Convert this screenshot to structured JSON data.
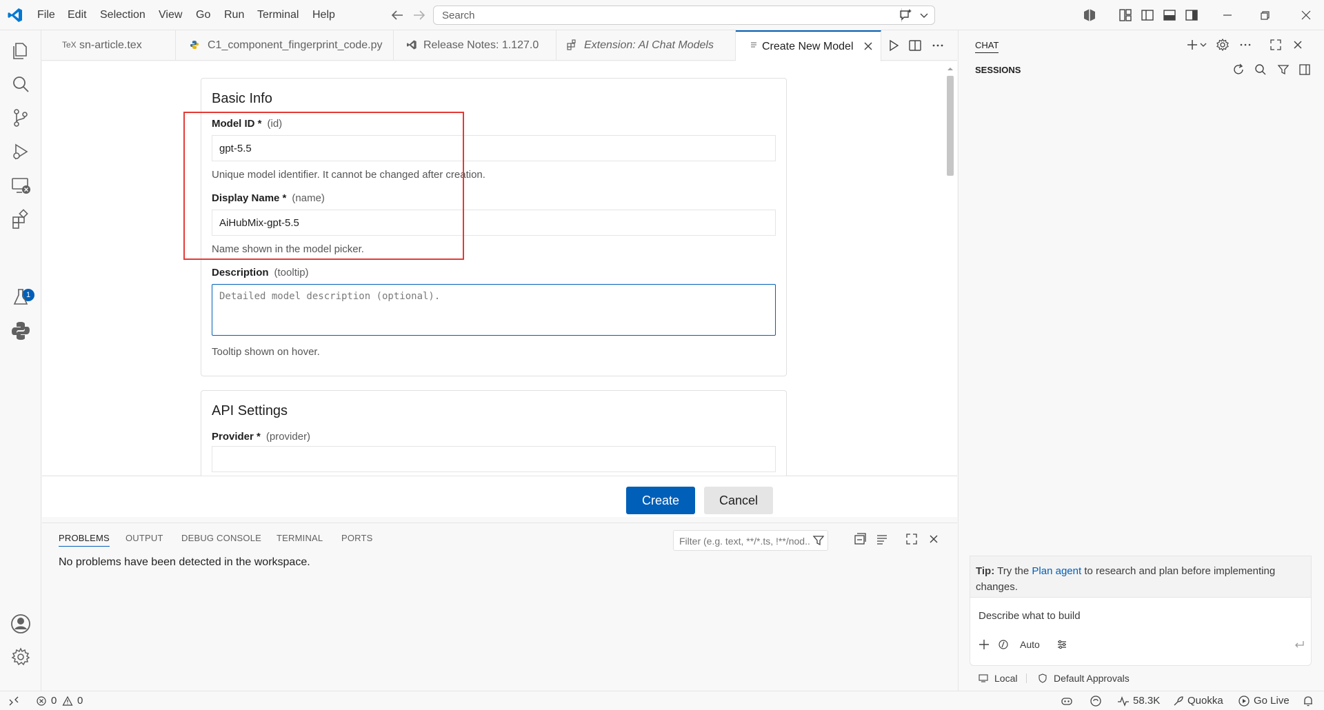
{
  "menu": [
    "File",
    "Edit",
    "Selection",
    "View",
    "Go",
    "Run",
    "Terminal",
    "Help"
  ],
  "search": {
    "placeholder": "Search"
  },
  "activity_badge": "1",
  "tabs": [
    {
      "label": "sn-article.tex",
      "icon": "tex-file-icon",
      "icon_text": "TeX"
    },
    {
      "label": "C1_component_fingerprint_code.py",
      "icon": "python-file-icon"
    },
    {
      "label": "Release Notes: 1.127.0",
      "icon": "vscode-icon"
    },
    {
      "label": "Extension: AI Chat Models",
      "icon": "extensions-icon"
    },
    {
      "label": "Create New Model",
      "icon": "preview-icon"
    }
  ],
  "form": {
    "basic_info_title": "Basic Info",
    "model_id": {
      "label": "Model ID *",
      "key": "(id)",
      "value": "gpt-5.5",
      "hint": "Unique model identifier. It cannot be changed after creation."
    },
    "display_name": {
      "label": "Display Name *",
      "key": "(name)",
      "value": "AiHubMix-gpt-5.5",
      "hint": "Name shown in the model picker."
    },
    "description": {
      "label": "Description",
      "key": "(tooltip)",
      "placeholder": "Detailed model description (optional).",
      "hint": "Tooltip shown on hover."
    },
    "api_settings_title": "API Settings",
    "provider": {
      "label": "Provider *",
      "key": "(provider)",
      "value": ""
    },
    "create_label": "Create",
    "cancel_label": "Cancel"
  },
  "panel": {
    "tabs": [
      "PROBLEMS",
      "OUTPUT",
      "DEBUG CONSOLE",
      "TERMINAL",
      "PORTS"
    ],
    "filter_placeholder": "Filter (e.g. text, **/*.ts, !**/nod...",
    "message": "No problems have been detected in the workspace."
  },
  "chat": {
    "title": "CHAT",
    "sessions": "SESSIONS",
    "tip_prefix": "Tip:",
    "tip_pre": "Try the",
    "tip_link": "Plan agent",
    "tip_post": "to research and plan before implementing changes.",
    "input_placeholder": "Describe what to build",
    "mode": "Auto",
    "location": "Local",
    "approvals": "Default Approvals"
  },
  "status": {
    "errors": "0",
    "warnings": "0",
    "tokens": "58.3K",
    "quokka": "Quokka",
    "go_live": "Go Live"
  },
  "colors": {
    "accent": "#005fb8",
    "highlight": "#e53935"
  }
}
